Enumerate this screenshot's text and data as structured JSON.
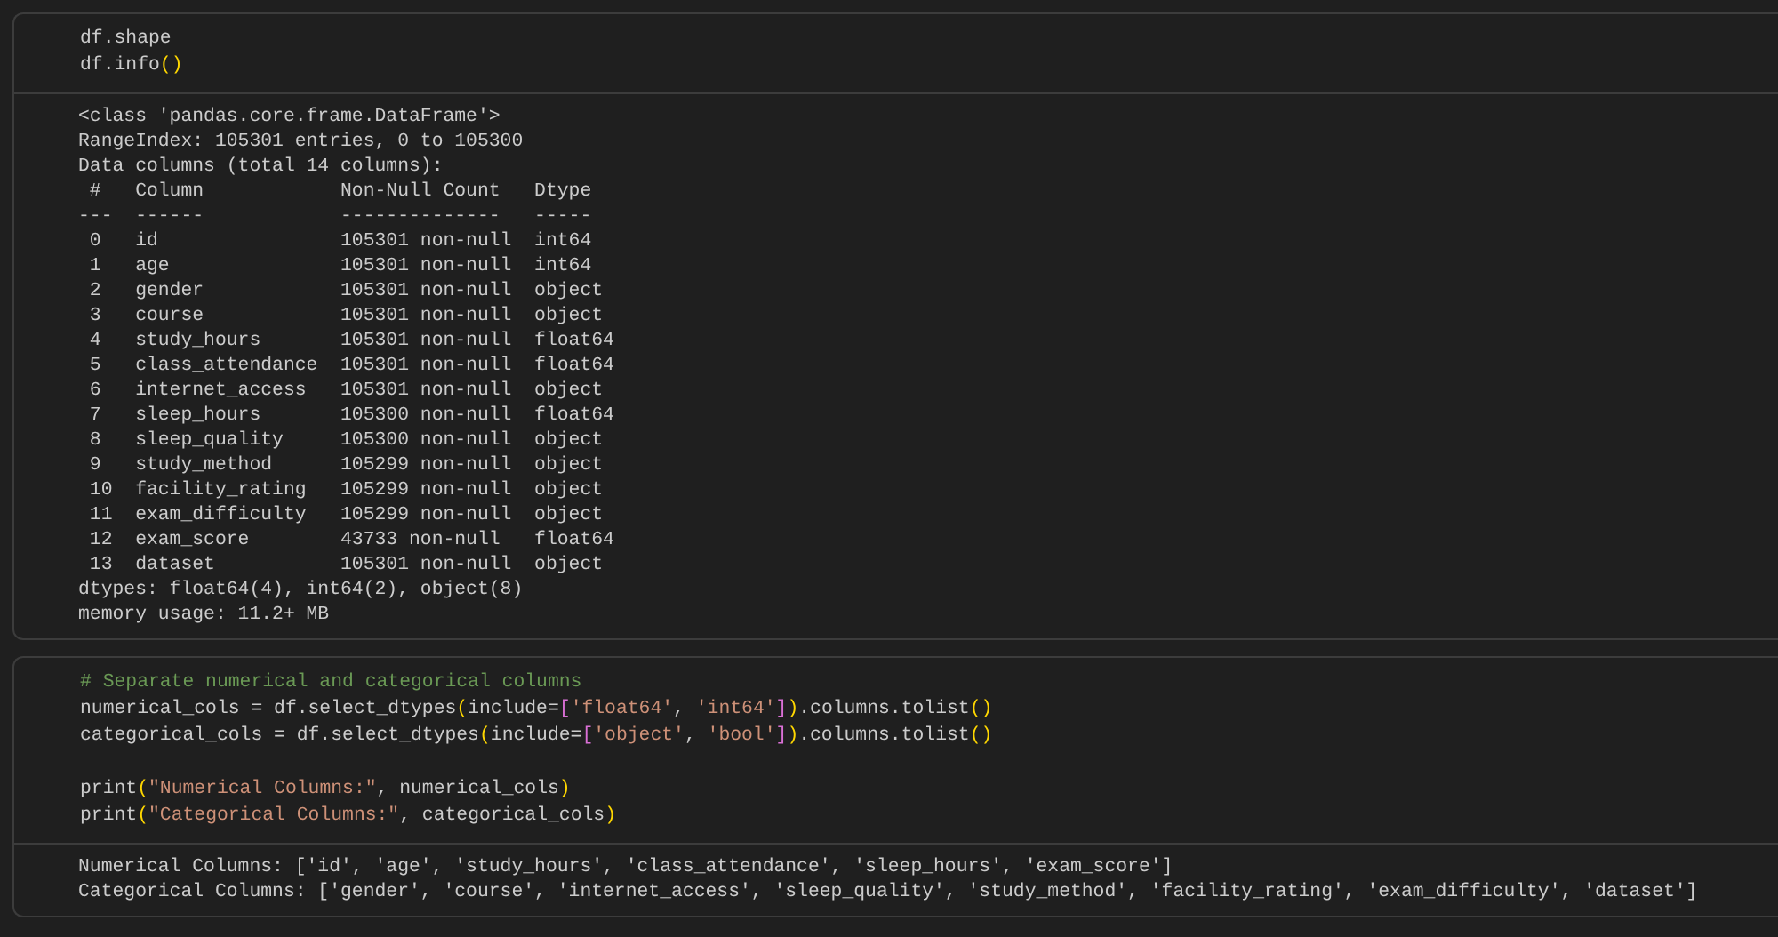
{
  "cells": [
    {
      "code_lines": [
        {
          "kind": "code",
          "tokens": [
            {
              "text": "df.shape",
              "kind": "plain"
            }
          ]
        },
        {
          "kind": "code",
          "tokens": [
            {
              "text": "df.info",
              "kind": "plain"
            },
            {
              "text": "()",
              "kind": "paren"
            }
          ]
        }
      ],
      "output_lines": [
        "<class 'pandas.core.frame.DataFrame'>",
        "RangeIndex: 105301 entries, 0 to 105300",
        "Data columns (total 14 columns):",
        " #   Column            Non-Null Count   Dtype  ",
        "---  ------            --------------   -----  ",
        " 0   id                105301 non-null  int64  ",
        " 1   age               105301 non-null  int64  ",
        " 2   gender            105301 non-null  object ",
        " 3   course            105301 non-null  object ",
        " 4   study_hours       105301 non-null  float64",
        " 5   class_attendance  105301 non-null  float64",
        " 6   internet_access   105301 non-null  object ",
        " 7   sleep_hours       105300 non-null  float64",
        " 8   sleep_quality     105300 non-null  object ",
        " 9   study_method      105299 non-null  object ",
        " 10  facility_rating   105299 non-null  object ",
        " 11  exam_difficulty   105299 non-null  object ",
        " 12  exam_score        43733 non-null   float64",
        " 13  dataset           105301 non-null  object ",
        "dtypes: float64(4), int64(2), object(8)",
        "memory usage: 11.2+ MB"
      ]
    },
    {
      "code_lines": [
        {
          "kind": "code",
          "tokens": [
            {
              "text": "# Separate numerical and categorical columns",
              "kind": "comment"
            }
          ]
        },
        {
          "kind": "code",
          "tokens": [
            {
              "text": "numerical_cols = df.select_dtypes",
              "kind": "plain"
            },
            {
              "text": "(",
              "kind": "paren"
            },
            {
              "text": "include=",
              "kind": "plain"
            },
            {
              "text": "[",
              "kind": "bracket"
            },
            {
              "text": "'float64'",
              "kind": "string"
            },
            {
              "text": ", ",
              "kind": "plain"
            },
            {
              "text": "'int64'",
              "kind": "string"
            },
            {
              "text": "]",
              "kind": "bracket"
            },
            {
              "text": ")",
              "kind": "paren"
            },
            {
              "text": ".columns.tolist",
              "kind": "plain"
            },
            {
              "text": "()",
              "kind": "paren"
            }
          ]
        },
        {
          "kind": "code",
          "tokens": [
            {
              "text": "categorical_cols = df.select_dtypes",
              "kind": "plain"
            },
            {
              "text": "(",
              "kind": "paren"
            },
            {
              "text": "include=",
              "kind": "plain"
            },
            {
              "text": "[",
              "kind": "bracket"
            },
            {
              "text": "'object'",
              "kind": "string"
            },
            {
              "text": ", ",
              "kind": "plain"
            },
            {
              "text": "'bool'",
              "kind": "string"
            },
            {
              "text": "]",
              "kind": "bracket"
            },
            {
              "text": ")",
              "kind": "paren"
            },
            {
              "text": ".columns.tolist",
              "kind": "plain"
            },
            {
              "text": "()",
              "kind": "paren"
            }
          ]
        },
        {
          "kind": "blank"
        },
        {
          "kind": "code",
          "tokens": [
            {
              "text": "print",
              "kind": "plain"
            },
            {
              "text": "(",
              "kind": "paren"
            },
            {
              "text": "\"Numerical Columns:\"",
              "kind": "string"
            },
            {
              "text": ", numerical_cols",
              "kind": "plain"
            },
            {
              "text": ")",
              "kind": "paren"
            }
          ]
        },
        {
          "kind": "code",
          "tokens": [
            {
              "text": "print",
              "kind": "plain"
            },
            {
              "text": "(",
              "kind": "paren"
            },
            {
              "text": "\"Categorical Columns:\"",
              "kind": "string"
            },
            {
              "text": ", categorical_cols",
              "kind": "plain"
            },
            {
              "text": ")",
              "kind": "paren"
            }
          ]
        }
      ],
      "output_lines": [
        "Numerical Columns: ['id', 'age', 'study_hours', 'class_attendance', 'sleep_hours', 'exam_score']",
        "Categorical Columns: ['gender', 'course', 'internet_access', 'sleep_quality', 'study_method', 'facility_rating', 'exam_difficulty', 'dataset']"
      ]
    }
  ]
}
